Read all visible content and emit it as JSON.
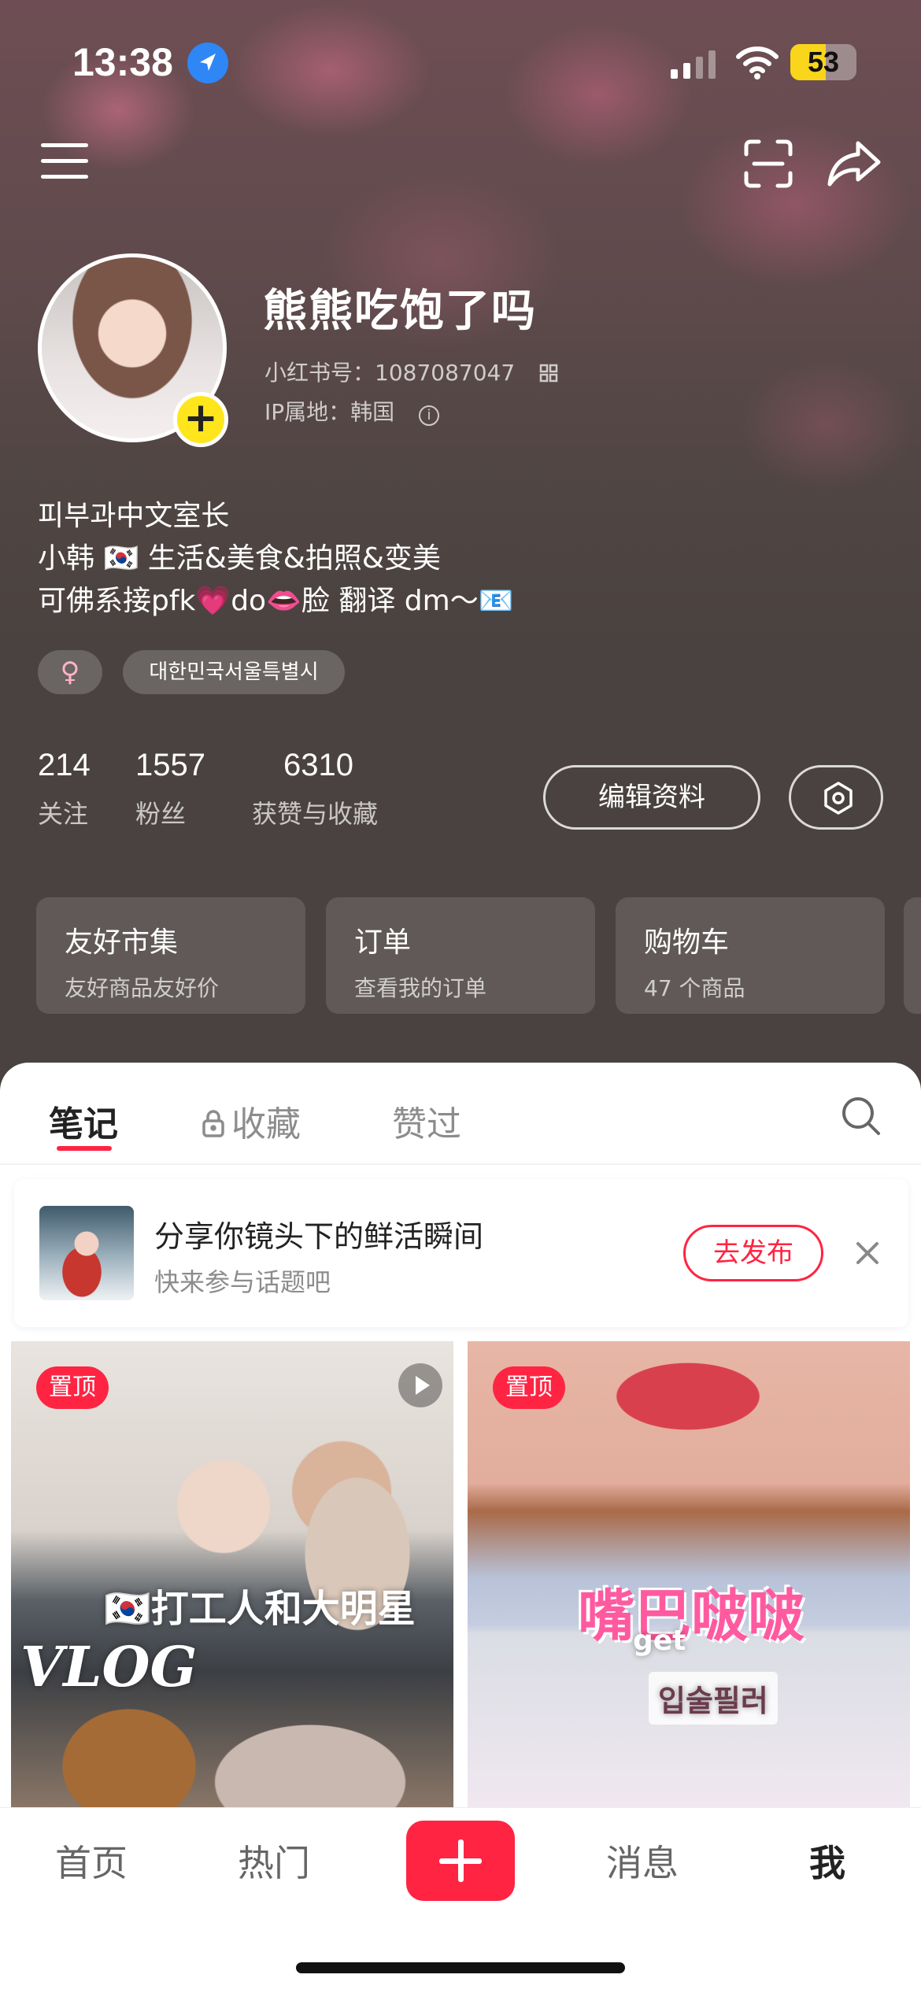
{
  "status_bar": {
    "time": "13:38",
    "battery": "53",
    "battery_level": 0.53
  },
  "profile": {
    "nickname": "熊熊吃饱了吗",
    "red_id": "小红书号：1087087047",
    "ip_location": "IP属地：韩国",
    "bio_lines": [
      "피부과中文室长",
      "小韩 🇰🇷 生活&美食&拍照&变美",
      "可佛系接pfk💗do👄脸 翻译 dm～📧"
    ],
    "gender_tag": "♀",
    "location_tag": "대한민국서울특별시",
    "stats": [
      {
        "value": "214",
        "label": "关注"
      },
      {
        "value": "1557",
        "label": "粉丝"
      },
      {
        "value": "6310",
        "label": "获赞与收藏"
      }
    ],
    "edit_button": "编辑资料"
  },
  "service_cards": [
    {
      "title": "友好市集",
      "subtitle": "友好商品友好价"
    },
    {
      "title": "订单",
      "subtitle": "查看我的订单"
    },
    {
      "title": "购物车",
      "subtitle": "47 个商品"
    }
  ],
  "tabs": [
    {
      "label": "笔记",
      "active": true
    },
    {
      "label": "收藏",
      "locked": true
    },
    {
      "label": "赞过"
    }
  ],
  "promo": {
    "title": "分享你镜头下的鲜活瞬间",
    "subtitle": "快来参与话题吧",
    "button": "去发布"
  },
  "notes": [
    {
      "pin": "置顶",
      "cover_text_1": "🇰🇷打工人和大明星",
      "cover_text_2": "VLOG",
      "is_video": true
    },
    {
      "pin": "置顶",
      "cover_text_1": "嘴巴啵啵",
      "cover_text_2": "get",
      "cover_text_3": "입술필러"
    }
  ],
  "tabbar": {
    "home": "首页",
    "hot": "热门",
    "messages": "消息",
    "me": "我"
  },
  "colors": {
    "brand": "#ff2442",
    "avatar_badge": "#ffe51c"
  }
}
